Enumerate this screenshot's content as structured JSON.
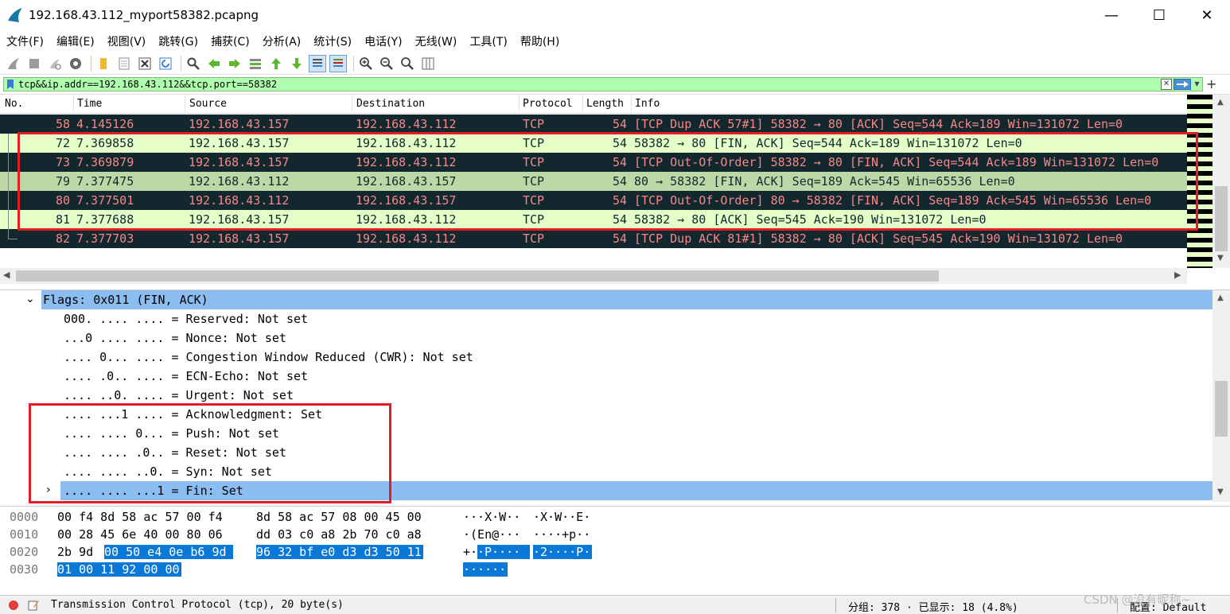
{
  "window": {
    "title": "192.168.43.112_myport58382.pcapng",
    "minimize": "—",
    "maximize": "☐",
    "close": "✕"
  },
  "menu": [
    "文件(F)",
    "编辑(E)",
    "视图(V)",
    "跳转(G)",
    "捕获(C)",
    "分析(A)",
    "统计(S)",
    "电话(Y)",
    "无线(W)",
    "工具(T)",
    "帮助(H)"
  ],
  "toolbar": {
    "icons": [
      "shark-fin-start-icon",
      "stop-icon",
      "restart-icon",
      "capture-options-icon",
      "open-file-icon",
      "file-icon",
      "close-file-icon",
      "reload-icon",
      "find-icon",
      "back-icon",
      "forward-icon",
      "goto-packet-icon",
      "first-packet-icon",
      "last-packet-icon",
      "autoscroll-icon",
      "colorize-icon",
      "zoom-in-icon",
      "zoom-out-icon",
      "zoom-reset-icon",
      "resize-columns-icon"
    ]
  },
  "filter": {
    "value": "tcp&&ip.addr==192.168.43.112&&tcp.port==58382",
    "clear": "✕",
    "plus": "+"
  },
  "packet_list": {
    "columns": [
      "No.",
      "Time",
      "Source",
      "Destination",
      "Protocol",
      "Length",
      "Info"
    ],
    "rows": [
      {
        "no": "58",
        "time": "4.145126",
        "src": "192.168.43.157",
        "dst": "192.168.43.112",
        "proto": "TCP",
        "len": "54",
        "info": "[TCP Dup ACK 57#1] 58382 → 80 [ACK] Seq=544 Ack=189 Win=131072 Len=0",
        "style": "dark"
      },
      {
        "no": "72",
        "time": "7.369858",
        "src": "192.168.43.157",
        "dst": "192.168.43.112",
        "proto": "TCP",
        "len": "54",
        "info": "58382 → 80 [FIN, ACK] Seq=544 Ack=189 Win=131072 Len=0",
        "style": "light"
      },
      {
        "no": "73",
        "time": "7.369879",
        "src": "192.168.43.157",
        "dst": "192.168.43.112",
        "proto": "TCP",
        "len": "54",
        "info": "[TCP Out-Of-Order] 58382 → 80 [FIN, ACK] Seq=544 Ack=189 Win=131072 Len=0",
        "style": "dark"
      },
      {
        "no": "79",
        "time": "7.377475",
        "src": "192.168.43.112",
        "dst": "192.168.43.157",
        "proto": "TCP",
        "len": "54",
        "info": "80 → 58382 [FIN, ACK] Seq=189 Ack=545 Win=65536 Len=0",
        "style": "sel"
      },
      {
        "no": "80",
        "time": "7.377501",
        "src": "192.168.43.112",
        "dst": "192.168.43.157",
        "proto": "TCP",
        "len": "54",
        "info": "[TCP Out-Of-Order] 80 → 58382 [FIN, ACK] Seq=189 Ack=545 Win=65536 Len=0",
        "style": "dark"
      },
      {
        "no": "81",
        "time": "7.377688",
        "src": "192.168.43.157",
        "dst": "192.168.43.112",
        "proto": "TCP",
        "len": "54",
        "info": "58382 → 80 [ACK] Seq=545 Ack=190 Win=131072 Len=0",
        "style": "light"
      },
      {
        "no": "82",
        "time": "7.377703",
        "src": "192.168.43.157",
        "dst": "192.168.43.112",
        "proto": "TCP",
        "len": "54",
        "info": "[TCP Dup ACK 81#1] 58382 → 80 [ACK] Seq=545 Ack=190 Win=131072 Len=0",
        "style": "dark"
      }
    ]
  },
  "details": {
    "flags_header": "Flags: 0x011 (FIN, ACK)",
    "lines": [
      "000. .... .... = Reserved: Not set",
      "...0 .... .... = Nonce: Not set",
      ".... 0... .... = Congestion Window Reduced (CWR): Not set",
      ".... .0.. .... = ECN-Echo: Not set",
      ".... ..0. .... = Urgent: Not set",
      ".... ...1 .... = Acknowledgment: Set",
      ".... .... 0... = Push: Not set",
      ".... .... .0.. = Reset: Not set",
      ".... .... ..0. = Syn: Not set",
      ".... .... ...1 = Fin: Set"
    ]
  },
  "bytes": {
    "rows": [
      {
        "offset": "0000",
        "hex_a": "00 f4 8d 58 ac 57 00 f4",
        "hex_b": "8d 58 ac 57 08 00 45 00",
        "ascii_a": "···X·W··",
        "ascii_b": "·X·W··E·"
      },
      {
        "offset": "0010",
        "hex_a": "00 28 45 6e 40 00 80 06",
        "hex_b": "dd 03 c0 a8 2b 70 c0 a8",
        "ascii_a": "·(En@···",
        "ascii_b": "····+p··"
      },
      {
        "offset": "0020",
        "hex_a_plain": "2b 9d",
        "hex_a_hl": "00 50 e4 0e b6 9d",
        "hex_b": "96 32 bf e0 d3 d3 50 11",
        "ascii_a_plain": "+·",
        "ascii_a_hl": "·P····",
        "ascii_b": "·2····P·"
      },
      {
        "offset": "0030",
        "hex_a_hl": "01 00 11 92 00 00",
        "ascii_a_hl": "······"
      }
    ]
  },
  "status": {
    "left": "Transmission Control Protocol (tcp), 20 byte(s)",
    "packets": "分组: 378 · 已显示: 18 (4.8%)",
    "profile": "配置: Default",
    "watermark": "CSDN @没有昵称~"
  },
  "colors": {
    "row_dark_bg": "#12272e",
    "row_dark_fg": "#f78787",
    "row_light_bg": "#e4ffc7",
    "row_selected_bg": "#bcd8a6",
    "filter_bg": "#afffaf",
    "detail_selected_bg": "#8cbdf0",
    "bytes_highlight": "#0a78d7",
    "annotation_red": "#e01e24"
  }
}
